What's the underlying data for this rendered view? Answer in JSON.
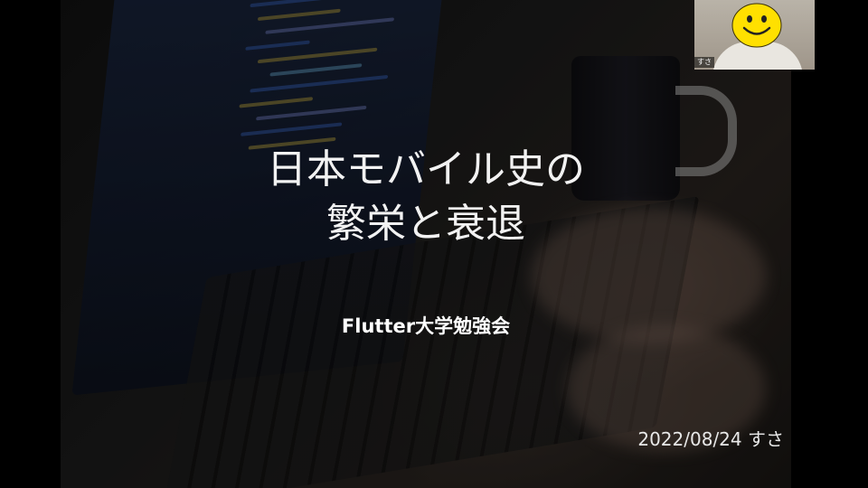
{
  "slide": {
    "title_line1": "日本モバイル史の",
    "title_line2": "繁栄と衰退",
    "subtitle": "Flutter大学勉強会",
    "date_author": "2022/08/24 すさ"
  },
  "video_tile": {
    "participant_label": "すさ",
    "avatar_icon": "smiley-face-icon"
  },
  "colors": {
    "letterbox": "#000000",
    "title_text": "#f2f2f2",
    "smiley_yellow": "#ffe000"
  }
}
